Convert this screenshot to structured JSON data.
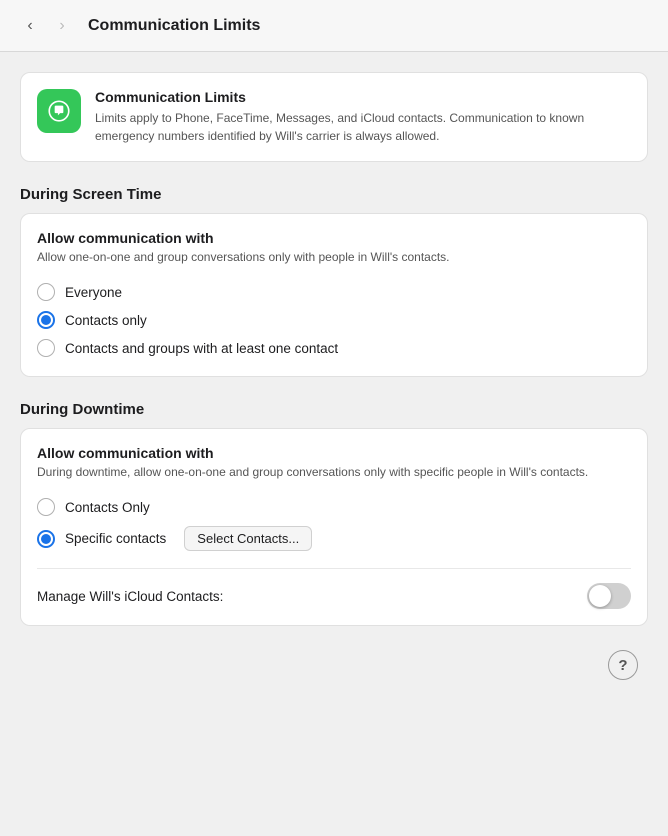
{
  "topbar": {
    "title": "Communication Limits",
    "back_enabled": true,
    "forward_enabled": false
  },
  "infoCard": {
    "title": "Communication Limits",
    "description": "Limits apply to Phone, FaceTime, Messages, and iCloud contacts. Communication to known emergency numbers identified by Will's carrier is always allowed.",
    "icon": "communication-icon"
  },
  "screenTime": {
    "sectionHeader": "During Screen Time",
    "cardTitle": "Allow communication with",
    "cardSubtitle": "Allow one-on-one and group conversations only with people in Will's contacts.",
    "options": [
      {
        "label": "Everyone",
        "selected": false
      },
      {
        "label": "Contacts only",
        "selected": true
      },
      {
        "label": "Contacts and groups with at least one contact",
        "selected": false
      }
    ]
  },
  "downtime": {
    "sectionHeader": "During Downtime",
    "cardTitle": "Allow communication with",
    "cardSubtitle": "During downtime, allow one-on-one and group conversations only with specific people in Will's contacts.",
    "options": [
      {
        "label": "Contacts Only",
        "selected": false
      },
      {
        "label": "Specific contacts",
        "selected": true
      }
    ],
    "selectButtonLabel": "Select Contacts...",
    "toggleRow": {
      "label": "Manage Will's iCloud Contacts:",
      "enabled": false
    }
  },
  "help": {
    "label": "?"
  }
}
